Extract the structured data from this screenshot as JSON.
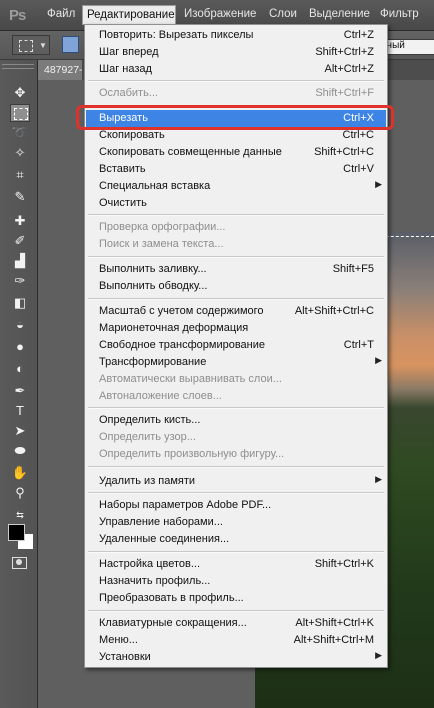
{
  "app": {
    "logo": "Ps"
  },
  "menubar": {
    "items": [
      "Файл",
      "Редактирование",
      "Изображение",
      "Слои",
      "Выделение",
      "Фильтр"
    ]
  },
  "options_bar": {
    "style_field": "рный"
  },
  "document": {
    "tab_label": "487927-"
  },
  "edit_menu": {
    "items": [
      {
        "label": "Повторить: Вырезать пикселы",
        "shortcut": "Ctrl+Z",
        "enabled": true
      },
      {
        "label": "Шаг вперед",
        "shortcut": "Shift+Ctrl+Z",
        "enabled": true
      },
      {
        "label": "Шаг назад",
        "shortcut": "Alt+Ctrl+Z",
        "enabled": true
      },
      {
        "label": "Ослабить...",
        "shortcut": "Shift+Ctrl+F",
        "enabled": false
      },
      {
        "label": "Вырезать",
        "shortcut": "Ctrl+X",
        "enabled": true,
        "highlighted": true
      },
      {
        "label": "Скопировать",
        "shortcut": "Ctrl+C",
        "enabled": true
      },
      {
        "label": "Скопировать совмещенные данные",
        "shortcut": "Shift+Ctrl+C",
        "enabled": true
      },
      {
        "label": "Вставить",
        "shortcut": "Ctrl+V",
        "enabled": true
      },
      {
        "label": "Специальная вставка",
        "shortcut": "",
        "enabled": true,
        "submenu": true
      },
      {
        "label": "Очистить",
        "shortcut": "",
        "enabled": true
      },
      {
        "label": "Проверка орфографии...",
        "shortcut": "",
        "enabled": false
      },
      {
        "label": "Поиск и замена текста...",
        "shortcut": "",
        "enabled": false
      },
      {
        "label": "Выполнить заливку...",
        "shortcut": "Shift+F5",
        "enabled": true
      },
      {
        "label": "Выполнить обводку...",
        "shortcut": "",
        "enabled": true
      },
      {
        "label": "Масштаб с учетом содержимого",
        "shortcut": "Alt+Shift+Ctrl+C",
        "enabled": true
      },
      {
        "label": "Марионеточная деформация",
        "shortcut": "",
        "enabled": true
      },
      {
        "label": "Свободное трансформирование",
        "shortcut": "Ctrl+T",
        "enabled": true
      },
      {
        "label": "Трансформирование",
        "shortcut": "",
        "enabled": true,
        "submenu": true
      },
      {
        "label": "Автоматически выравнивать слои...",
        "shortcut": "",
        "enabled": false
      },
      {
        "label": "Автоналожение слоев...",
        "shortcut": "",
        "enabled": false
      },
      {
        "label": "Определить кисть...",
        "shortcut": "",
        "enabled": true
      },
      {
        "label": "Определить узор...",
        "shortcut": "",
        "enabled": false
      },
      {
        "label": "Определить произвольную фигуру...",
        "shortcut": "",
        "enabled": false
      },
      {
        "label": "Удалить из памяти",
        "shortcut": "",
        "enabled": true,
        "submenu": true
      },
      {
        "label": "Наборы параметров Adobe PDF...",
        "shortcut": "",
        "enabled": true
      },
      {
        "label": "Управление наборами...",
        "shortcut": "",
        "enabled": true
      },
      {
        "label": "Удаленные соединения...",
        "shortcut": "",
        "enabled": true
      },
      {
        "label": "Настройка цветов...",
        "shortcut": "Shift+Ctrl+K",
        "enabled": true
      },
      {
        "label": "Назначить профиль...",
        "shortcut": "",
        "enabled": true
      },
      {
        "label": "Преобразовать в профиль...",
        "shortcut": "",
        "enabled": true
      },
      {
        "label": "Клавиатурные сокращения...",
        "shortcut": "Alt+Shift+Ctrl+K",
        "enabled": true
      },
      {
        "label": "Меню...",
        "shortcut": "Alt+Shift+Ctrl+M",
        "enabled": true
      },
      {
        "label": "Установки",
        "shortcut": "",
        "enabled": true,
        "submenu": true
      }
    ]
  },
  "colors": {
    "highlight": "#3d84e4",
    "callout": "#e0312b",
    "foreground_swatch": "#000000",
    "background_swatch": "#ffffff"
  },
  "tools": [
    "move-icon",
    "rect-marquee-icon",
    "lasso-icon",
    "quick-select-icon",
    "crop-icon",
    "eyedropper-icon",
    "spot-heal-icon",
    "brush-icon",
    "clone-stamp-icon",
    "history-brush-icon",
    "eraser-icon",
    "paint-bucket-icon",
    "blur-icon",
    "dodge-icon",
    "pen-icon",
    "type-icon",
    "path-select-icon",
    "ellipse-shape-icon",
    "hand-icon",
    "zoom-icon"
  ]
}
